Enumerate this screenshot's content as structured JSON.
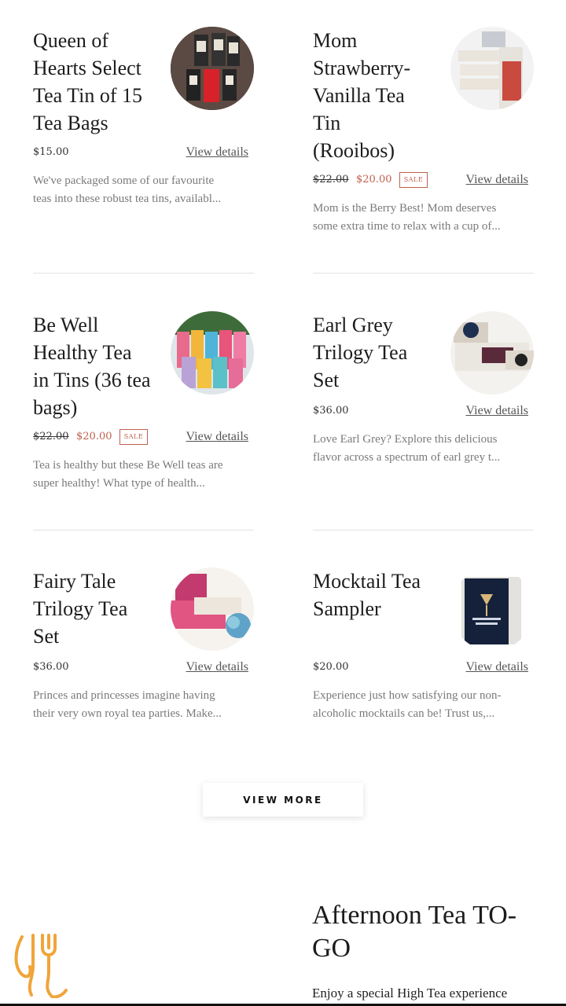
{
  "products": [
    {
      "title": "Queen of Hearts Select Tea Tin of 15 Tea Bags",
      "price": "$15.00",
      "old_price": "",
      "sale_price": "",
      "badge": "",
      "link": "View details",
      "desc1": "We've packaged some of our favourite",
      "desc2": "teas into these robust tea tins, availabl..."
    },
    {
      "title": "Mom Strawberry-Vanilla Tea Tin (Rooibos)",
      "price": "",
      "old_price": "$22.00",
      "sale_price": "$20.00",
      "badge": "SALE",
      "link": "View details",
      "desc1": "Mom is the Berry Best! Mom deserves",
      "desc2": "some extra time to relax with a cup of..."
    },
    {
      "title": "Be Well Healthy Tea in Tins (36 tea bags)",
      "price": "",
      "old_price": "$22.00",
      "sale_price": "$20.00",
      "badge": "SALE",
      "link": "View details",
      "desc1": "Tea is healthy but these Be Well teas are",
      "desc2": "super healthy! What type of health..."
    },
    {
      "title": "Earl Grey Trilogy Tea Set",
      "price": "$36.00",
      "old_price": "",
      "sale_price": "",
      "badge": "",
      "link": "View details",
      "desc1": "Love Earl Grey? Explore this delicious",
      "desc2": "flavor across a spectrum of earl grey t..."
    },
    {
      "title": "Fairy Tale Trilogy Tea Set",
      "price": "$36.00",
      "old_price": "",
      "sale_price": "",
      "badge": "",
      "link": "View details",
      "desc1": "Princes and princesses imagine having",
      "desc2": "their very own royal tea parties. Make..."
    },
    {
      "title": "Mocktail Tea Sampler",
      "price": "$20.00",
      "old_price": "",
      "sale_price": "",
      "badge": "",
      "link": "View details",
      "desc1": "Experience just how satisfying our non-",
      "desc2": "alcoholic mocktails can be! Trust us,..."
    }
  ],
  "view_more_label": "VIEW MORE",
  "section": {
    "title": "Afternoon Tea TO-GO",
    "text": "Enjoy a special High Tea experience"
  },
  "colors": {
    "sale": "#c0604f",
    "logo": "#f0a53a"
  },
  "icons": {
    "logo": "fork-spoon-logo-icon"
  }
}
